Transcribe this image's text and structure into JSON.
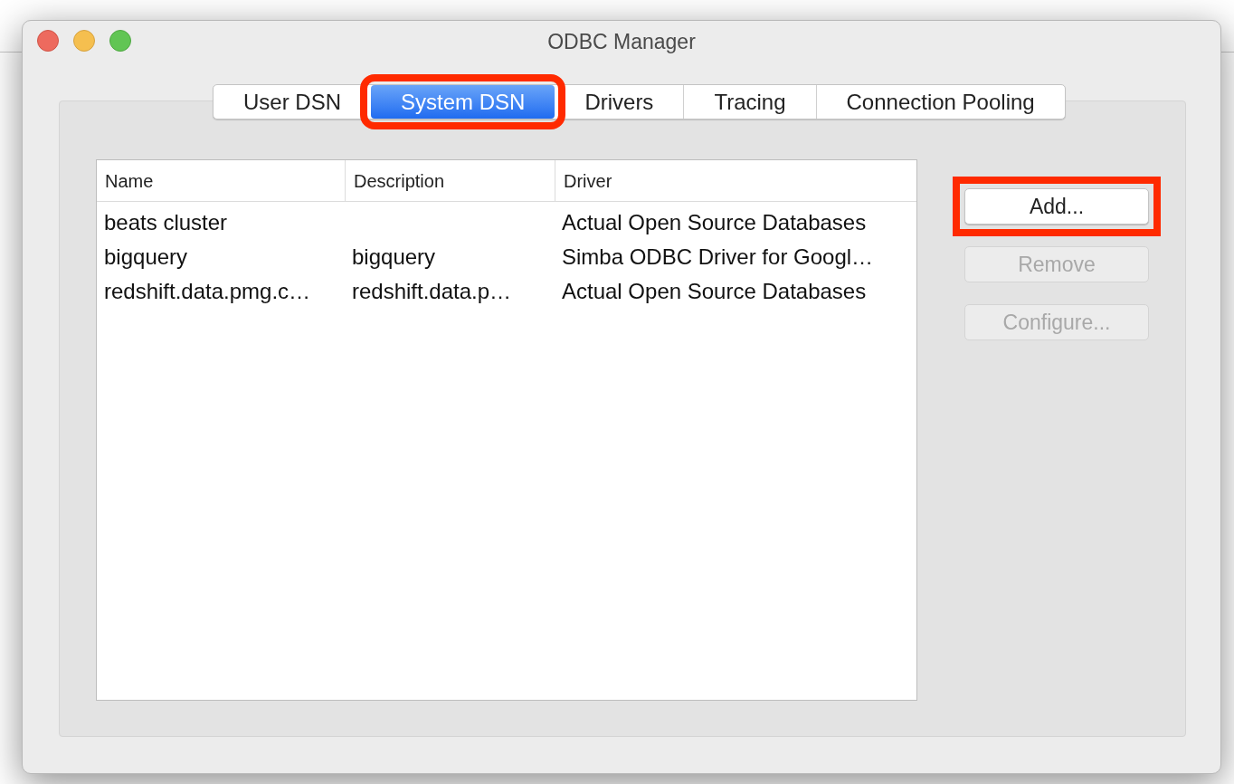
{
  "window": {
    "title": "ODBC Manager"
  },
  "tabs": [
    {
      "label": "User DSN",
      "selected": false,
      "highlighted": false
    },
    {
      "label": "System DSN",
      "selected": true,
      "highlighted": true
    },
    {
      "label": "Drivers",
      "selected": false,
      "highlighted": false
    },
    {
      "label": "Tracing",
      "selected": false,
      "highlighted": false
    },
    {
      "label": "Connection Pooling",
      "selected": false,
      "highlighted": false
    }
  ],
  "table": {
    "columns": [
      "Name",
      "Description",
      "Driver"
    ],
    "rows": [
      [
        "beats cluster",
        "",
        "Actual Open Source Databases"
      ],
      [
        "bigquery",
        "bigquery",
        "Simba ODBC Driver for Googl…"
      ],
      [
        "redshift.data.pmg.c…",
        "redshift.data.p…",
        "Actual Open Source Databases"
      ]
    ]
  },
  "buttons": [
    {
      "label": "Add...",
      "disabled": false,
      "highlighted": true
    },
    {
      "label": "Remove",
      "disabled": true,
      "highlighted": false
    },
    {
      "label": "Configure...",
      "disabled": true,
      "highlighted": false
    }
  ]
}
